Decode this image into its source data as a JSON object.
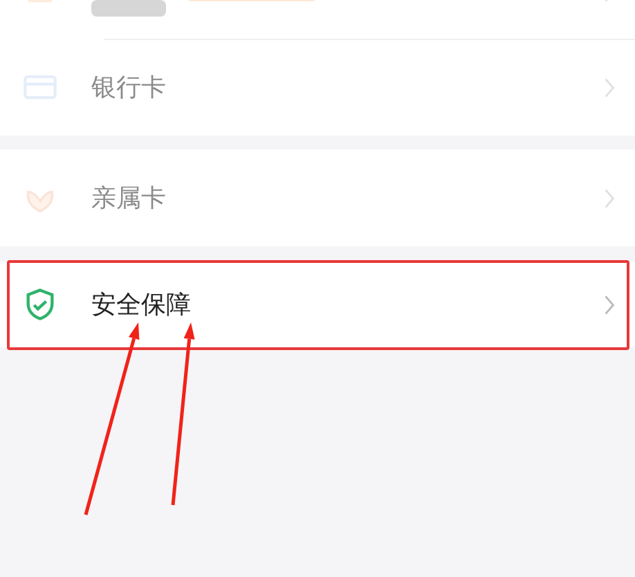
{
  "groups": [
    {
      "items": [
        {
          "kind": "wallet",
          "faded": true,
          "highlighted": false
        },
        {
          "kind": "card",
          "label": "银行卡",
          "faded": true,
          "highlighted": false
        }
      ]
    },
    {
      "items": [
        {
          "kind": "hands",
          "label": "亲属卡",
          "faded": true,
          "highlighted": false
        }
      ]
    },
    {
      "items": [
        {
          "kind": "shield",
          "label": "安全保障",
          "faded": false,
          "highlighted": true
        }
      ]
    }
  ]
}
